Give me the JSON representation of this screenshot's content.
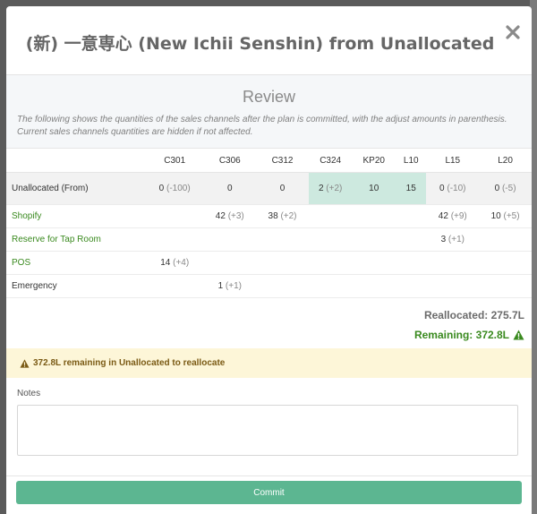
{
  "modal": {
    "title": "(新) 一意専心 (New Ichii Senshin) from Unallocated",
    "close_icon": "close-icon"
  },
  "review": {
    "title": "Review",
    "description": "The following shows the quantities of the sales channels after the plan is committed, with the adjust amounts in parenthesis. Current sales channels quantities are hidden if not affected."
  },
  "table": {
    "columns": [
      "",
      "C301",
      "C306",
      "C312",
      "C324",
      "KP20",
      "L10",
      "L15",
      "L20"
    ],
    "rows": [
      {
        "label": "Unallocated (From)",
        "cells": [
          {
            "value": "0",
            "adj": "(-100)"
          },
          {
            "value": "0",
            "adj": ""
          },
          {
            "value": "0",
            "adj": ""
          },
          {
            "value": "2",
            "adj": "(+2)"
          },
          {
            "value": "10",
            "adj": ""
          },
          {
            "value": "15",
            "adj": ""
          },
          {
            "value": "0",
            "adj": "(-10)"
          },
          {
            "value": "0",
            "adj": "(-5)"
          }
        ]
      },
      {
        "label": "Shopify",
        "cells": [
          {
            "value": "",
            "adj": ""
          },
          {
            "value": "42",
            "adj": "(+3)"
          },
          {
            "value": "38",
            "adj": "(+2)"
          },
          {
            "value": "",
            "adj": ""
          },
          {
            "value": "",
            "adj": ""
          },
          {
            "value": "",
            "adj": ""
          },
          {
            "value": "42",
            "adj": "(+9)"
          },
          {
            "value": "10",
            "adj": "(+5)"
          }
        ]
      },
      {
        "label": "Reserve for Tap Room",
        "cells": [
          {
            "value": "",
            "adj": ""
          },
          {
            "value": "",
            "adj": ""
          },
          {
            "value": "",
            "adj": ""
          },
          {
            "value": "",
            "adj": ""
          },
          {
            "value": "",
            "adj": ""
          },
          {
            "value": "",
            "adj": ""
          },
          {
            "value": "3",
            "adj": "(+1)"
          },
          {
            "value": "",
            "adj": ""
          }
        ]
      },
      {
        "label": "POS",
        "cells": [
          {
            "value": "14",
            "adj": "(+4)"
          },
          {
            "value": "",
            "adj": ""
          },
          {
            "value": "",
            "adj": ""
          },
          {
            "value": "",
            "adj": ""
          },
          {
            "value": "",
            "adj": ""
          },
          {
            "value": "",
            "adj": ""
          },
          {
            "value": "",
            "adj": ""
          },
          {
            "value": "",
            "adj": ""
          }
        ]
      },
      {
        "label": "Emergency",
        "cells": [
          {
            "value": "",
            "adj": ""
          },
          {
            "value": "1",
            "adj": "(+1)"
          },
          {
            "value": "",
            "adj": ""
          },
          {
            "value": "",
            "adj": ""
          },
          {
            "value": "",
            "adj": ""
          },
          {
            "value": "",
            "adj": ""
          },
          {
            "value": "",
            "adj": ""
          },
          {
            "value": "",
            "adj": ""
          }
        ]
      }
    ]
  },
  "totals": {
    "reallocated": "Reallocated: 275.7L",
    "remaining": "Remaining: 372.8L"
  },
  "alert": {
    "text": "372.8L remaining in Unallocated to reallocate"
  },
  "notes": {
    "label": "Notes",
    "value": ""
  },
  "commit": {
    "label": "Commit"
  },
  "colors": {
    "accent_green": "#3a8a1f",
    "commit_button": "#5cb691",
    "highlight_cell": "#cde9df",
    "alert_bg": "#fdf6d8"
  }
}
